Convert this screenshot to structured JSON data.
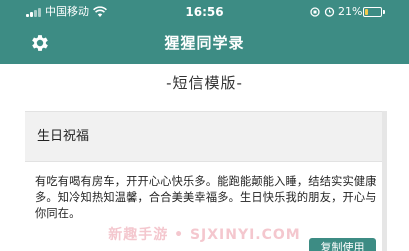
{
  "status_bar": {
    "carrier": "中国移动",
    "time": "16:56",
    "battery_percent": "21%",
    "battery_level": 0.21,
    "icons": [
      "signal-icon",
      "wifi-icon",
      "orientation-lock-icon",
      "alarm-icon",
      "battery-icon"
    ]
  },
  "nav": {
    "title": "猩猩同学录",
    "settings_icon": "gear-icon"
  },
  "page": {
    "title": "-短信模版-"
  },
  "card": {
    "title": "生日祝福",
    "body": "有吃有喝有房车，开开心心快乐多。能跑能颠能入睡，结结实实健康多。知冷知热知温馨，合合美美幸福多。生日快乐我的朋友，开心与你同在。",
    "copy_button": "复制使用"
  },
  "watermark": "新趣手游 • SJXINYI.COM",
  "colors": {
    "accent": "#3d8c84",
    "card_header_bg": "#f1f1f1",
    "text": "#222222"
  }
}
